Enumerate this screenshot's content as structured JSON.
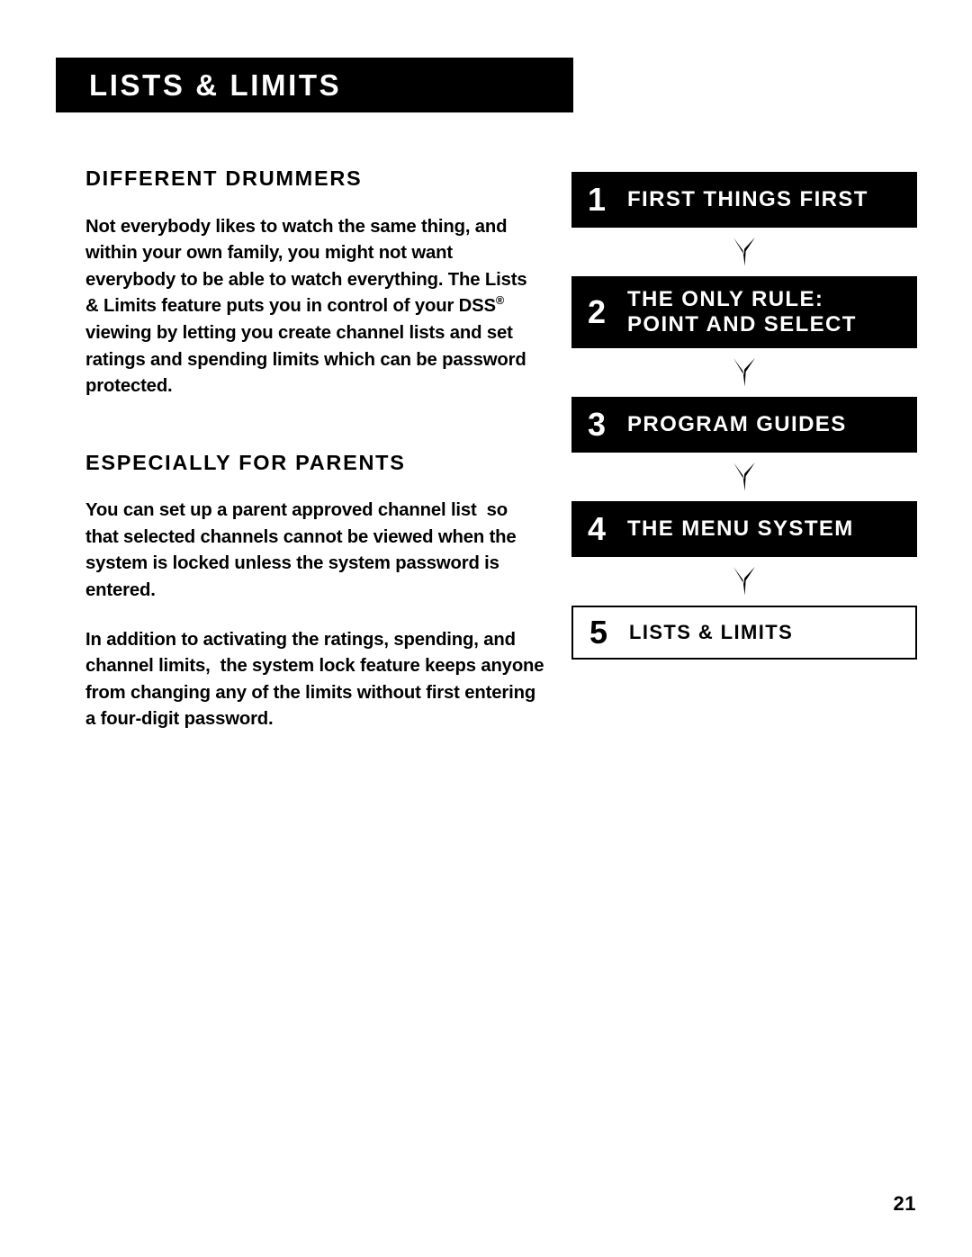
{
  "page": {
    "banner_title": "LISTS & LIMITS",
    "page_number": "21",
    "colors": {
      "ink": "#000000",
      "paper": "#ffffff"
    }
  },
  "content": {
    "sections": [
      {
        "heading": "DIFFERENT DRUMMERS",
        "paragraphs": [
          "Not everybody likes to watch the same thing, and within your own family, you might not want everybody to be able to watch everything. The Lists & Limits feature puts you in control of your DSS® viewing by letting you create channel lists and set ratings and spending limits which can be password protected."
        ]
      },
      {
        "heading": "ESPECIALLY FOR PARENTS",
        "paragraphs": [
          "You can set up a parent approved channel list  so that selected channels cannot be viewed when the system is locked unless the system password is entered.",
          "In addition to activating the ratings, spending, and channel limits,  the system lock feature keeps anyone from changing any of the limits without first entering a four-digit password."
        ]
      }
    ]
  },
  "nav_flow": {
    "steps": [
      {
        "number": "1",
        "label": "FIRST THINGS FIRST",
        "current": false
      },
      {
        "number": "2",
        "label": "THE ONLY RULE:\nPOINT AND SELECT",
        "current": false
      },
      {
        "number": "3",
        "label": "PROGRAM GUIDES",
        "current": false
      },
      {
        "number": "4",
        "label": "THE MENU SYSTEM",
        "current": false
      },
      {
        "number": "5",
        "label": "LISTS & LIMITS",
        "current": true
      }
    ],
    "connector_icon": "down-dart-arrow-icon"
  }
}
